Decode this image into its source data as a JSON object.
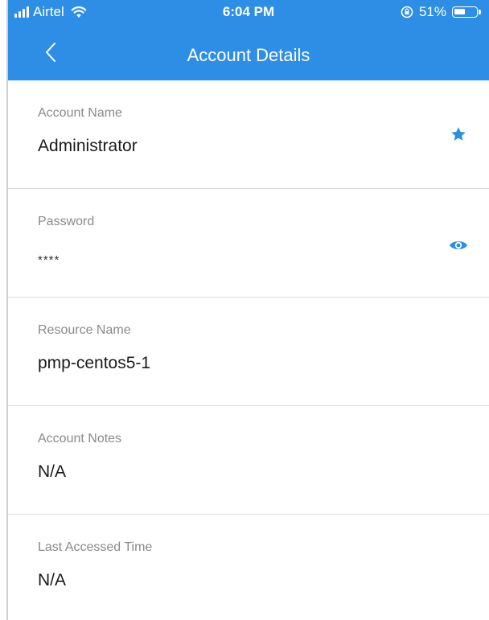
{
  "status_bar": {
    "carrier": "Airtel",
    "time": "6:04 PM",
    "battery_percent": "51%",
    "battery_level": 0.51
  },
  "header": {
    "title": "Account Details",
    "back_icon": "chevron-left-icon"
  },
  "fields": [
    {
      "label": "Account Name",
      "value": "Administrator",
      "icon": "star-icon"
    },
    {
      "label": "Password",
      "value": "****",
      "icon": "eye-icon"
    },
    {
      "label": "Resource Name",
      "value": "pmp-centos5-1"
    },
    {
      "label": "Account Notes",
      "value": "N/A"
    },
    {
      "label": "Last Accessed Time",
      "value": "N/A"
    }
  ],
  "colors": {
    "accent": "#2e8ee5",
    "icon": "#2b8fdd"
  }
}
